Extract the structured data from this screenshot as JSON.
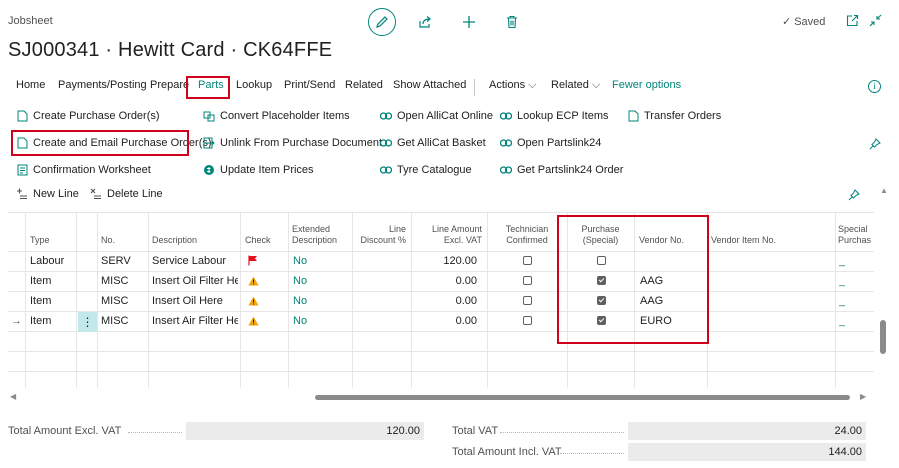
{
  "header": {
    "kind": "Jobsheet",
    "title": "SJ000341 · Hewitt Card · CK64FFE",
    "saved": "Saved",
    "icons": [
      "edit-icon",
      "share-icon",
      "add-icon",
      "delete-icon",
      "open-new-window-icon",
      "collapse-icon"
    ]
  },
  "actions": {
    "items": [
      "Home",
      "Payments/Posting",
      "Prepare",
      "Parts",
      "Lookup",
      "Print/Send",
      "Related",
      "Show Attached"
    ],
    "menus": [
      "Actions",
      "Related"
    ],
    "fewer": "Fewer options"
  },
  "parts_menu": {
    "col1": [
      "Create Purchase Order(s)",
      "Create and Email Purchase Order(s)",
      "Confirmation Worksheet"
    ],
    "col2": [
      "Convert Placeholder Items",
      "Unlink From Purchase Document",
      "Update Item Prices"
    ],
    "col3": [
      "Open AlliCat Online",
      "Get AlliCat Basket",
      "Tyre Catalogue"
    ],
    "col4": [
      "Lookup ECP Items",
      "Open Partslink24",
      "Get Partslink24 Order"
    ],
    "col5": [
      "Transfer Orders"
    ]
  },
  "grid_toolbar": {
    "new_line": "New Line",
    "delete_line": "Delete Line"
  },
  "grid": {
    "headers": {
      "type": "Type",
      "no": "No.",
      "description": "Description",
      "check": "Check",
      "extended": [
        "Extended",
        "Description"
      ],
      "line_discount": [
        "Line",
        "Discount %"
      ],
      "line_amount": [
        "Line Amount",
        "Excl. VAT"
      ],
      "technician": [
        "Technician",
        "Confirmed"
      ],
      "purchase": [
        "Purchase",
        "(Special)"
      ],
      "vendor_no": "Vendor No.",
      "vendor_item_no": "Vendor Item No.",
      "special": [
        "Special",
        "Purchas"
      ]
    },
    "rows": [
      {
        "type": "Labour",
        "no": "SERV",
        "description": "Service Labour",
        "check": "flag",
        "extended": "No",
        "line_amount": "120.00",
        "technician": false,
        "purchase": false,
        "vendor_no": "",
        "special": "_"
      },
      {
        "type": "Item",
        "no": "MISC",
        "description": "Insert Oil Filter He...",
        "check": "warning",
        "extended": "No",
        "line_amount": "0.00",
        "technician": false,
        "purchase": true,
        "vendor_no": "AAG",
        "special": "_"
      },
      {
        "type": "Item",
        "no": "MISC",
        "description": "Insert Oil Here",
        "check": "warning",
        "extended": "No",
        "line_amount": "0.00",
        "technician": false,
        "purchase": true,
        "vendor_no": "AAG",
        "special": "_"
      },
      {
        "type": "Item",
        "no": "MISC",
        "description": "Insert Air Filter He...",
        "check": "warning",
        "extended": "No",
        "line_amount": "0.00",
        "technician": false,
        "purchase": true,
        "vendor_no": "EURO",
        "special": "_"
      }
    ]
  },
  "totals": {
    "excl_label": "Total Amount Excl. VAT",
    "excl_value": "120.00",
    "vat_label": "Total VAT",
    "vat_value": "24.00",
    "incl_label": "Total Amount Incl. VAT",
    "incl_value": "144.00"
  },
  "colors": {
    "accent": "#00857a",
    "highlight": "#d0021b",
    "warning": "#f0a30a",
    "flag": "#e81123"
  }
}
